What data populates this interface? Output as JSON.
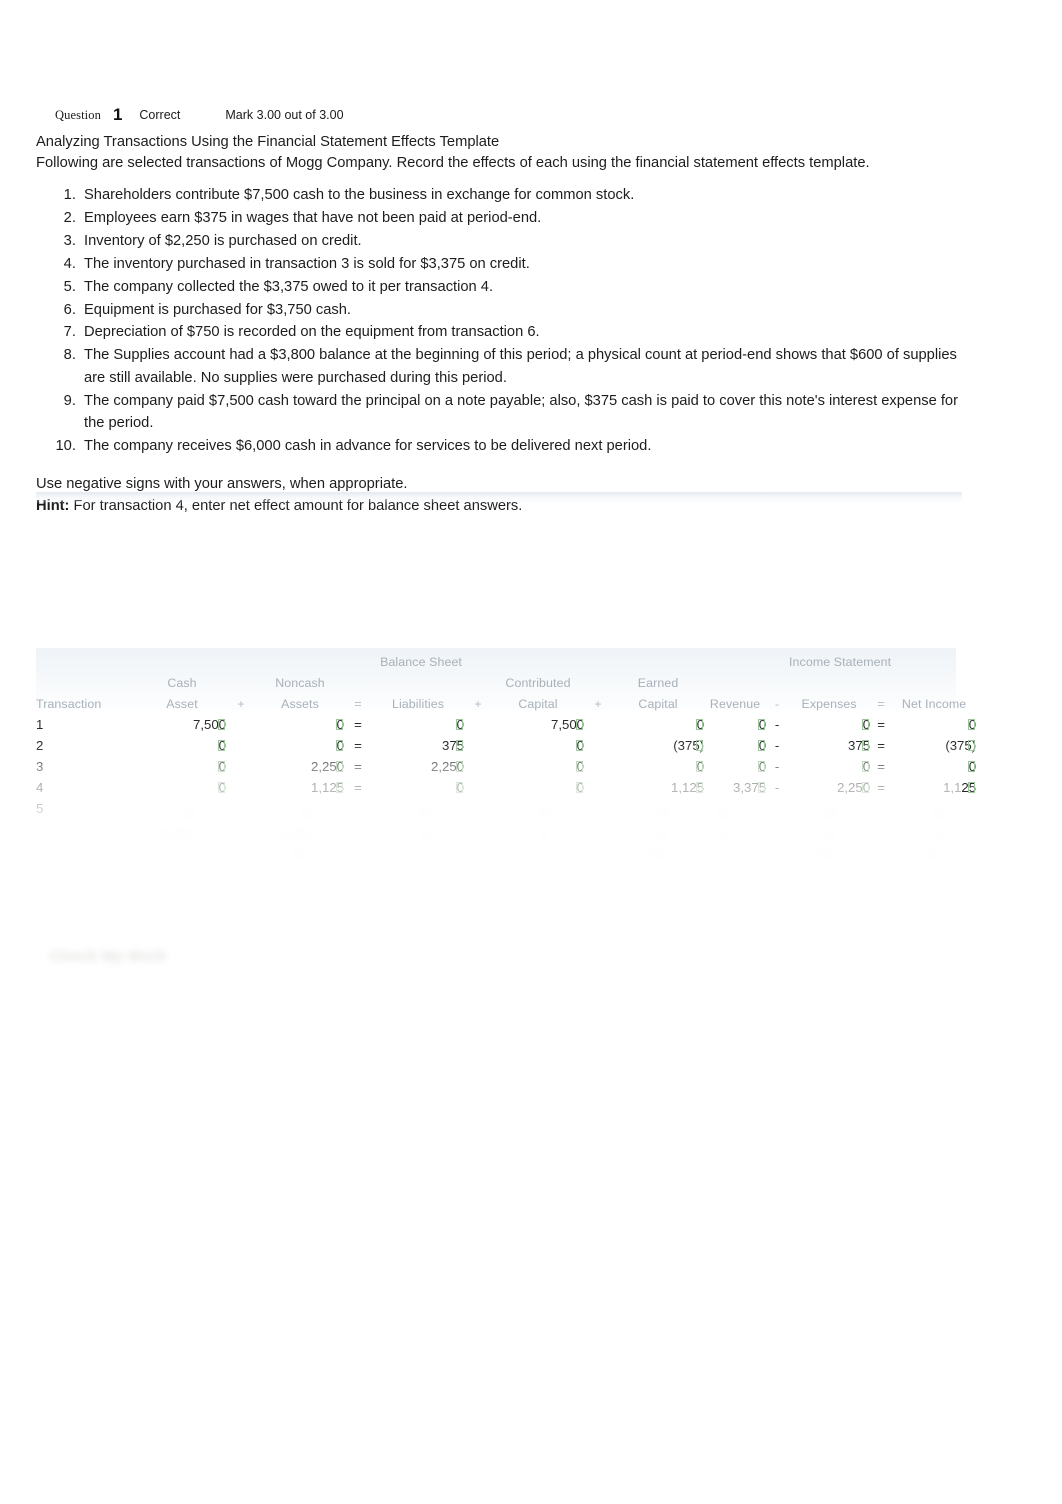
{
  "question_header": {
    "label": "Question",
    "number": "1",
    "state": "Correct",
    "mark": "Mark 3.00 out of 3.00"
  },
  "body": {
    "title": "Analyzing Transactions Using the Financial Statement Effects Template",
    "intro": "Following are selected transactions of Mogg Company. Record the effects of each using the financial statement effects template.",
    "transactions": [
      "Shareholders contribute $7,500 cash to the business in exchange for common stock.",
      "Employees earn $375 in wages that have not been paid at period-end.",
      "Inventory of $2,250 is purchased on credit.",
      "The inventory purchased in transaction 3 is sold for $3,375 on credit.",
      "The company collected the $3,375 owed to it per transaction 4.",
      "Equipment is purchased for $3,750 cash.",
      "Depreciation of $750 is recorded on the equipment from transaction 6.",
      "The Supplies account had a $3,800 balance at the beginning of this period; a physical count at period-end shows that $600 of supplies are still available. No supplies were purchased during this period.",
      "The company paid $7,500 cash toward the principal on a note payable; also, $375 cash is paid to cover this note's interest expense for the period.",
      "The company receives $6,000 cash in advance for services to be delivered next period."
    ],
    "instruction": "Use negative signs with your answers, when appropriate.",
    "hint_label": "Hint:",
    "hint_text": "For transaction 4, enter net effect amount for balance sheet answers."
  },
  "table": {
    "group_balance_sheet": "Balance Sheet",
    "group_income_statement": "Income Statement",
    "headers_top": {
      "cash": "Cash",
      "noncash": "Noncash",
      "contributed": "Contributed",
      "earned": "Earned"
    },
    "headers_bottom": {
      "transaction": "Transaction",
      "cash_asset": "Asset",
      "noncash_assets": "Assets",
      "liabilities": "Liabilities",
      "contributed_capital": "Capital",
      "earned_capital": "Capital",
      "revenue": "Revenue",
      "expenses": "Expenses",
      "net_income": "Net Income"
    },
    "operators": {
      "plus1": "+",
      "equals1": "=",
      "plus2": "+",
      "plus3": "+",
      "minus": "-",
      "equals2": "="
    },
    "rows": [
      {
        "transaction": "1",
        "cash_asset": "7,500",
        "noncash_assets": "0",
        "eq": "=",
        "liabilities": "0",
        "contributed_capital": "7,500",
        "earned_capital": "0",
        "revenue": "0",
        "minus": "-",
        "expenses": "0",
        "eq2": "=",
        "net_income": "0"
      },
      {
        "transaction": "2",
        "cash_asset": "0",
        "noncash_assets": "0",
        "eq": "=",
        "liabilities": "375",
        "contributed_capital": "0",
        "earned_capital": "(375)",
        "revenue": "0",
        "minus": "-",
        "expenses": "375",
        "eq2": "=",
        "net_income": "(375)"
      },
      {
        "transaction": "3",
        "cash_asset": "0",
        "noncash_assets": "2,250",
        "eq": "=",
        "liabilities": "2,250",
        "contributed_capital": "0",
        "earned_capital": "0",
        "revenue": "0",
        "minus": "-",
        "expenses": "0",
        "eq2": "=",
        "net_income": "0"
      },
      {
        "transaction": "4",
        "cash_asset": "0",
        "noncash_assets": "1,125",
        "eq": "=",
        "liabilities": "0",
        "contributed_capital": "0",
        "earned_capital": "1,125",
        "revenue": "3,375",
        "minus": "-",
        "expenses": "2,250",
        "eq2": "=",
        "net_income": "1,125"
      },
      {
        "transaction": "5",
        "cash_asset": "",
        "noncash_assets": "",
        "eq": "",
        "liabilities": "",
        "contributed_capital": "",
        "earned_capital": "",
        "revenue": "",
        "minus": "",
        "expenses": "",
        "eq2": "",
        "net_income": ""
      }
    ]
  },
  "footer": {
    "faded_action": "Check My Work"
  }
}
